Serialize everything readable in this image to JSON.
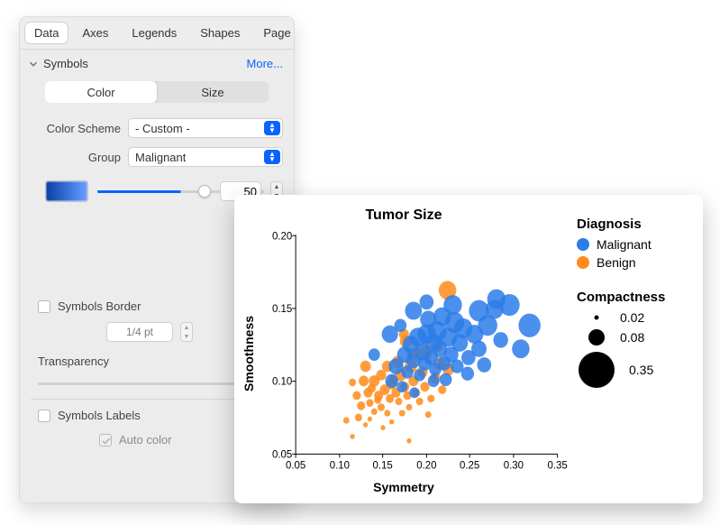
{
  "tabs": {
    "t0": "Data",
    "t1": "Axes",
    "t2": "Legends",
    "t3": "Shapes",
    "t4": "Page"
  },
  "section": {
    "title": "Symbols",
    "more": "More..."
  },
  "seg": {
    "color": "Color",
    "size": "Size"
  },
  "form": {
    "color_scheme_label": "Color Scheme",
    "color_scheme_value": "- Custom -",
    "group_label": "Group",
    "group_value": "Malignant",
    "blue_value": "50"
  },
  "border": {
    "label": "Symbols Border",
    "size_value": "1/4 pt"
  },
  "transparency_label": "Transparency",
  "symbols_labels_label": "Symbols Labels",
  "auto_color_label": "Auto color",
  "chart": {
    "title": "Tumor Size",
    "xlabel": "Symmetry",
    "ylabel": "Smoothness",
    "legend_title": "Diagnosis",
    "legend1": "Malignant",
    "legend2": "Benign",
    "size_legend_title": "Compactness",
    "size1": "0.02",
    "size2": "0.08",
    "size3": "0.35",
    "colors": {
      "malignant": "#2b7de9",
      "benign": "#ff8c1a"
    },
    "xt1": "0.05",
    "xt2": "0.10",
    "xt3": "0.15",
    "xt4": "0.20",
    "xt5": "0.25",
    "xt6": "0.30",
    "xt7": "0.35",
    "yt1": "0.05",
    "yt2": "0.10",
    "yt3": "0.15",
    "yt4": "0.20"
  },
  "chart_data": {
    "type": "scatter",
    "title": "Tumor Size",
    "xlabel": "Symmetry",
    "ylabel": "Smoothness",
    "xlim": [
      0.05,
      0.35
    ],
    "ylim": [
      0.05,
      0.2
    ],
    "size_encoding": {
      "field": "Compactness",
      "domain": [
        0.02,
        0.35
      ]
    },
    "color_encoding": {
      "field": "Diagnosis",
      "categories": [
        "Malignant",
        "Benign"
      ],
      "colors": [
        "#2b7de9",
        "#ff8c1a"
      ]
    },
    "legend_sizes": [
      0.02,
      0.08,
      0.35
    ],
    "series": [
      {
        "name": "Benign",
        "color": "#ff8c1a",
        "points": [
          {
            "x": 0.108,
            "y": 0.073,
            "s": 0.04
          },
          {
            "x": 0.115,
            "y": 0.062,
            "s": 0.03
          },
          {
            "x": 0.122,
            "y": 0.075,
            "s": 0.05
          },
          {
            "x": 0.125,
            "y": 0.083,
            "s": 0.06
          },
          {
            "x": 0.13,
            "y": 0.07,
            "s": 0.03
          },
          {
            "x": 0.133,
            "y": 0.092,
            "s": 0.07
          },
          {
            "x": 0.135,
            "y": 0.085,
            "s": 0.05
          },
          {
            "x": 0.14,
            "y": 0.1,
            "s": 0.09
          },
          {
            "x": 0.14,
            "y": 0.079,
            "s": 0.04
          },
          {
            "x": 0.145,
            "y": 0.09,
            "s": 0.07
          },
          {
            "x": 0.148,
            "y": 0.082,
            "s": 0.05
          },
          {
            "x": 0.152,
            "y": 0.094,
            "s": 0.08
          },
          {
            "x": 0.155,
            "y": 0.078,
            "s": 0.04
          },
          {
            "x": 0.158,
            "y": 0.088,
            "s": 0.06
          },
          {
            "x": 0.16,
            "y": 0.098,
            "s": 0.09
          },
          {
            "x": 0.16,
            "y": 0.072,
            "s": 0.03
          },
          {
            "x": 0.165,
            "y": 0.092,
            "s": 0.07
          },
          {
            "x": 0.168,
            "y": 0.086,
            "s": 0.05
          },
          {
            "x": 0.17,
            "y": 0.104,
            "s": 0.1
          },
          {
            "x": 0.172,
            "y": 0.078,
            "s": 0.04
          },
          {
            "x": 0.175,
            "y": 0.096,
            "s": 0.07
          },
          {
            "x": 0.178,
            "y": 0.09,
            "s": 0.06
          },
          {
            "x": 0.18,
            "y": 0.082,
            "s": 0.04
          },
          {
            "x": 0.182,
            "y": 0.11,
            "s": 0.11
          },
          {
            "x": 0.185,
            "y": 0.1,
            "s": 0.08
          },
          {
            "x": 0.188,
            "y": 0.092,
            "s": 0.06
          },
          {
            "x": 0.19,
            "y": 0.118,
            "s": 0.12
          },
          {
            "x": 0.192,
            "y": 0.086,
            "s": 0.05
          },
          {
            "x": 0.195,
            "y": 0.106,
            "s": 0.09
          },
          {
            "x": 0.198,
            "y": 0.096,
            "s": 0.07
          },
          {
            "x": 0.2,
            "y": 0.12,
            "s": 0.12
          },
          {
            "x": 0.205,
            "y": 0.088,
            "s": 0.05
          },
          {
            "x": 0.21,
            "y": 0.102,
            "s": 0.09
          },
          {
            "x": 0.215,
            "y": 0.112,
            "s": 0.11
          },
          {
            "x": 0.218,
            "y": 0.094,
            "s": 0.06
          },
          {
            "x": 0.225,
            "y": 0.108,
            "s": 0.1
          },
          {
            "x": 0.128,
            "y": 0.1,
            "s": 0.08
          },
          {
            "x": 0.15,
            "y": 0.068,
            "s": 0.03
          },
          {
            "x": 0.137,
            "y": 0.095,
            "s": 0.06
          },
          {
            "x": 0.167,
            "y": 0.113,
            "s": 0.1
          },
          {
            "x": 0.174,
            "y": 0.132,
            "s": 0.08
          },
          {
            "x": 0.18,
            "y": 0.059,
            "s": 0.03
          },
          {
            "x": 0.162,
            "y": 0.101,
            "s": 0.07
          },
          {
            "x": 0.144,
            "y": 0.087,
            "s": 0.05
          },
          {
            "x": 0.12,
            "y": 0.09,
            "s": 0.06
          },
          {
            "x": 0.115,
            "y": 0.099,
            "s": 0.05
          },
          {
            "x": 0.135,
            "y": 0.074,
            "s": 0.03
          },
          {
            "x": 0.155,
            "y": 0.11,
            "s": 0.09
          },
          {
            "x": 0.202,
            "y": 0.077,
            "s": 0.04
          },
          {
            "x": 0.212,
            "y": 0.124,
            "s": 0.11
          },
          {
            "x": 0.224,
            "y": 0.162,
            "s": 0.2
          },
          {
            "x": 0.176,
            "y": 0.127,
            "s": 0.1
          },
          {
            "x": 0.184,
            "y": 0.118,
            "s": 0.09
          },
          {
            "x": 0.148,
            "y": 0.104,
            "s": 0.08
          },
          {
            "x": 0.13,
            "y": 0.11,
            "s": 0.09
          }
        ]
      },
      {
        "name": "Malignant",
        "color": "#2b7de9",
        "points": [
          {
            "x": 0.16,
            "y": 0.1,
            "s": 0.12
          },
          {
            "x": 0.165,
            "y": 0.11,
            "s": 0.15
          },
          {
            "x": 0.17,
            "y": 0.138,
            "s": 0.11
          },
          {
            "x": 0.175,
            "y": 0.118,
            "s": 0.16
          },
          {
            "x": 0.178,
            "y": 0.106,
            "s": 0.11
          },
          {
            "x": 0.182,
            "y": 0.125,
            "s": 0.18
          },
          {
            "x": 0.185,
            "y": 0.114,
            "s": 0.14
          },
          {
            "x": 0.19,
            "y": 0.13,
            "s": 0.2
          },
          {
            "x": 0.192,
            "y": 0.104,
            "s": 0.1
          },
          {
            "x": 0.195,
            "y": 0.12,
            "s": 0.17
          },
          {
            "x": 0.198,
            "y": 0.112,
            "s": 0.13
          },
          {
            "x": 0.2,
            "y": 0.132,
            "s": 0.22
          },
          {
            "x": 0.202,
            "y": 0.142,
            "s": 0.18
          },
          {
            "x": 0.205,
            "y": 0.116,
            "s": 0.14
          },
          {
            "x": 0.208,
            "y": 0.126,
            "s": 0.19
          },
          {
            "x": 0.21,
            "y": 0.108,
            "s": 0.11
          },
          {
            "x": 0.212,
            "y": 0.134,
            "s": 0.23
          },
          {
            "x": 0.215,
            "y": 0.122,
            "s": 0.16
          },
          {
            "x": 0.218,
            "y": 0.144,
            "s": 0.2
          },
          {
            "x": 0.22,
            "y": 0.112,
            "s": 0.13
          },
          {
            "x": 0.225,
            "y": 0.13,
            "s": 0.21
          },
          {
            "x": 0.228,
            "y": 0.118,
            "s": 0.15
          },
          {
            "x": 0.232,
            "y": 0.14,
            "s": 0.24
          },
          {
            "x": 0.235,
            "y": 0.11,
            "s": 0.12
          },
          {
            "x": 0.238,
            "y": 0.126,
            "s": 0.18
          },
          {
            "x": 0.242,
            "y": 0.136,
            "s": 0.22
          },
          {
            "x": 0.248,
            "y": 0.116,
            "s": 0.14
          },
          {
            "x": 0.255,
            "y": 0.132,
            "s": 0.2
          },
          {
            "x": 0.26,
            "y": 0.148,
            "s": 0.25
          },
          {
            "x": 0.26,
            "y": 0.122,
            "s": 0.16
          },
          {
            "x": 0.27,
            "y": 0.138,
            "s": 0.24
          },
          {
            "x": 0.28,
            "y": 0.156,
            "s": 0.22
          },
          {
            "x": 0.285,
            "y": 0.128,
            "s": 0.15
          },
          {
            "x": 0.295,
            "y": 0.152,
            "s": 0.26
          },
          {
            "x": 0.308,
            "y": 0.122,
            "s": 0.2
          },
          {
            "x": 0.318,
            "y": 0.138,
            "s": 0.3
          },
          {
            "x": 0.158,
            "y": 0.132,
            "s": 0.18
          },
          {
            "x": 0.172,
            "y": 0.096,
            "s": 0.09
          },
          {
            "x": 0.185,
            "y": 0.148,
            "s": 0.19
          },
          {
            "x": 0.208,
            "y": 0.1,
            "s": 0.1
          },
          {
            "x": 0.186,
            "y": 0.092,
            "s": 0.08
          },
          {
            "x": 0.222,
            "y": 0.101,
            "s": 0.11
          },
          {
            "x": 0.247,
            "y": 0.105,
            "s": 0.12
          },
          {
            "x": 0.14,
            "y": 0.118,
            "s": 0.1
          },
          {
            "x": 0.23,
            "y": 0.152,
            "s": 0.22
          },
          {
            "x": 0.2,
            "y": 0.154,
            "s": 0.14
          },
          {
            "x": 0.266,
            "y": 0.111,
            "s": 0.14
          },
          {
            "x": 0.278,
            "y": 0.149,
            "s": 0.21
          }
        ]
      }
    ]
  }
}
